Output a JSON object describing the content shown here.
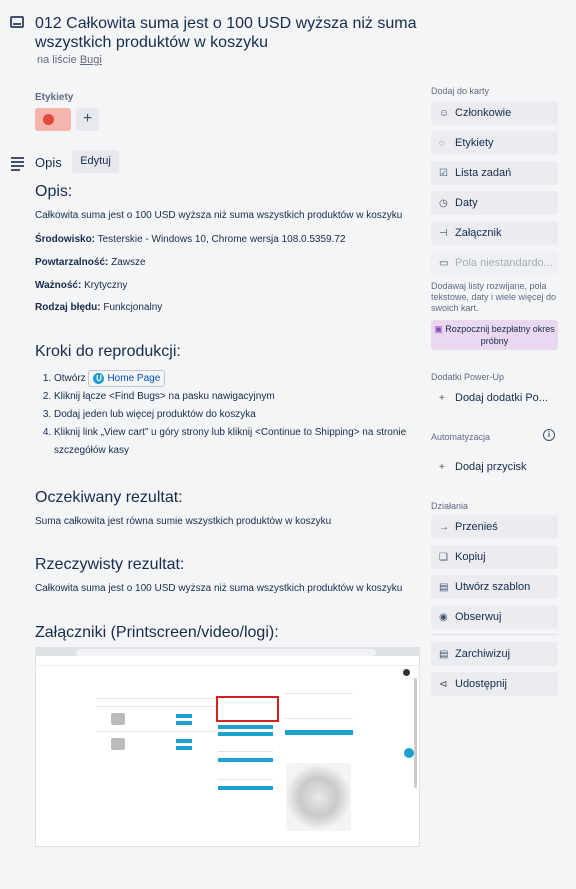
{
  "card": {
    "title": "012 Całkowita suma jest o 100 USD wyższa niż suma wszystkich produktów w koszyku",
    "list_prefix": "na liście",
    "list_name": "Bugi"
  },
  "labels": {
    "heading": "Etykiety",
    "chip_color": "#f5b5ad",
    "dot_color": "#e2483d",
    "add": "+"
  },
  "description": {
    "heading": "Opis",
    "edit_label": "Edytuj",
    "h_opis": "Opis:",
    "summary": "Całkowita suma jest o 100 USD wyższa niż suma wszystkich produktów w koszyku",
    "env_label": "Środowisko:",
    "env_value": "Testerskie - Windows 10, Chrome wersja 108.0.5359.72",
    "repeat_label": "Powtarzalność:",
    "repeat_value": "Zawsze",
    "severity_label": "Ważność:",
    "severity_value": "Krytyczny",
    "type_label": "Rodzaj błędu:",
    "type_value": "Funkcjonalny",
    "h_steps": "Kroki do reprodukcji:",
    "step1_prefix": "Otwórz",
    "step1_link": "Home Page",
    "step2": "Kliknij łącze <Find Bugs> na pasku nawigacyjnym",
    "step3": "Dodaj jeden lub więcej produktów do koszyka",
    "step4": "Kliknij link „View cart” u góry strony lub kliknij <Continue to Shipping> na stronie szczegółów kasy",
    "h_expected": "Oczekiwany rezultat:",
    "expected": "Suma całkowita jest równa sumie wszystkich produktów w koszyku",
    "h_actual": "Rzeczywisty rezultat:",
    "actual": "Całkowita suma jest o 100 USD wyższa niż suma wszystkich produktów w koszyku",
    "h_attachments": "Załączniki (Printscreen/video/logi):"
  },
  "sidebar": {
    "add_to_card": "Dodaj do karty",
    "members": "Członkowie",
    "labels": "Etykiety",
    "checklist": "Lista zadań",
    "dates": "Daty",
    "attachment": "Załącznik",
    "custom_fields": "Pola niestandardo...",
    "note": "Dodawaj listy rozwijane, pola tekstowe, daty i wiele więcej do swoich kart.",
    "trial": "Rozpocznij bezpłatny okres próbny",
    "powerups_heading": "Dodatki Power-Up",
    "add_powerups": "Dodaj dodatki Po...",
    "automation_heading": "Automatyzacja",
    "add_button": "Dodaj przycisk",
    "actions_heading": "Działania",
    "move": "Przenieś",
    "copy": "Kopiuj",
    "template": "Utwórz szablon",
    "watch": "Obserwuj",
    "archive": "Zarchiwizuj",
    "share": "Udostępnij"
  }
}
